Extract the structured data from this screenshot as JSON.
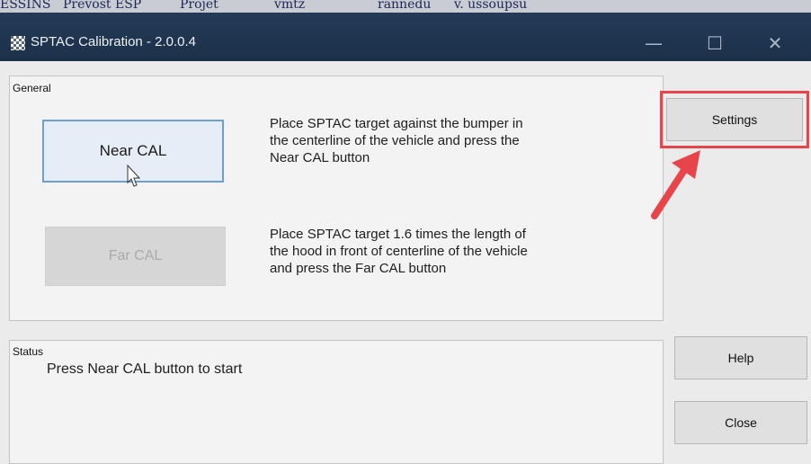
{
  "taskbar": {
    "items": [
      "ESSINS",
      "Prevost ESP",
      "Projet",
      "vmtz",
      "rannedu",
      "v. ussoupsu"
    ]
  },
  "window": {
    "title": "SPTAC Calibration - 2.0.0.4",
    "controls": {
      "minimize": "—",
      "maximize": "☐",
      "close": "✕"
    }
  },
  "general": {
    "label": "General",
    "near_cal": {
      "button": "Near CAL",
      "instructions": [
        "Place SPTAC target against the bumper in",
        "the centerline of the vehicle and press the",
        "Near CAL button"
      ]
    },
    "far_cal": {
      "button": "Far CAL",
      "instructions": [
        "Place SPTAC target 1.6 times the length of",
        "the hood in front of centerline of the vehicle",
        "and press the Far CAL button"
      ]
    }
  },
  "status": {
    "label": "Status",
    "message": "Press Near CAL button to start"
  },
  "side_buttons": {
    "settings": "Settings",
    "help": "Help",
    "close": "Close"
  },
  "annotation": {
    "color": "#e7454a"
  }
}
